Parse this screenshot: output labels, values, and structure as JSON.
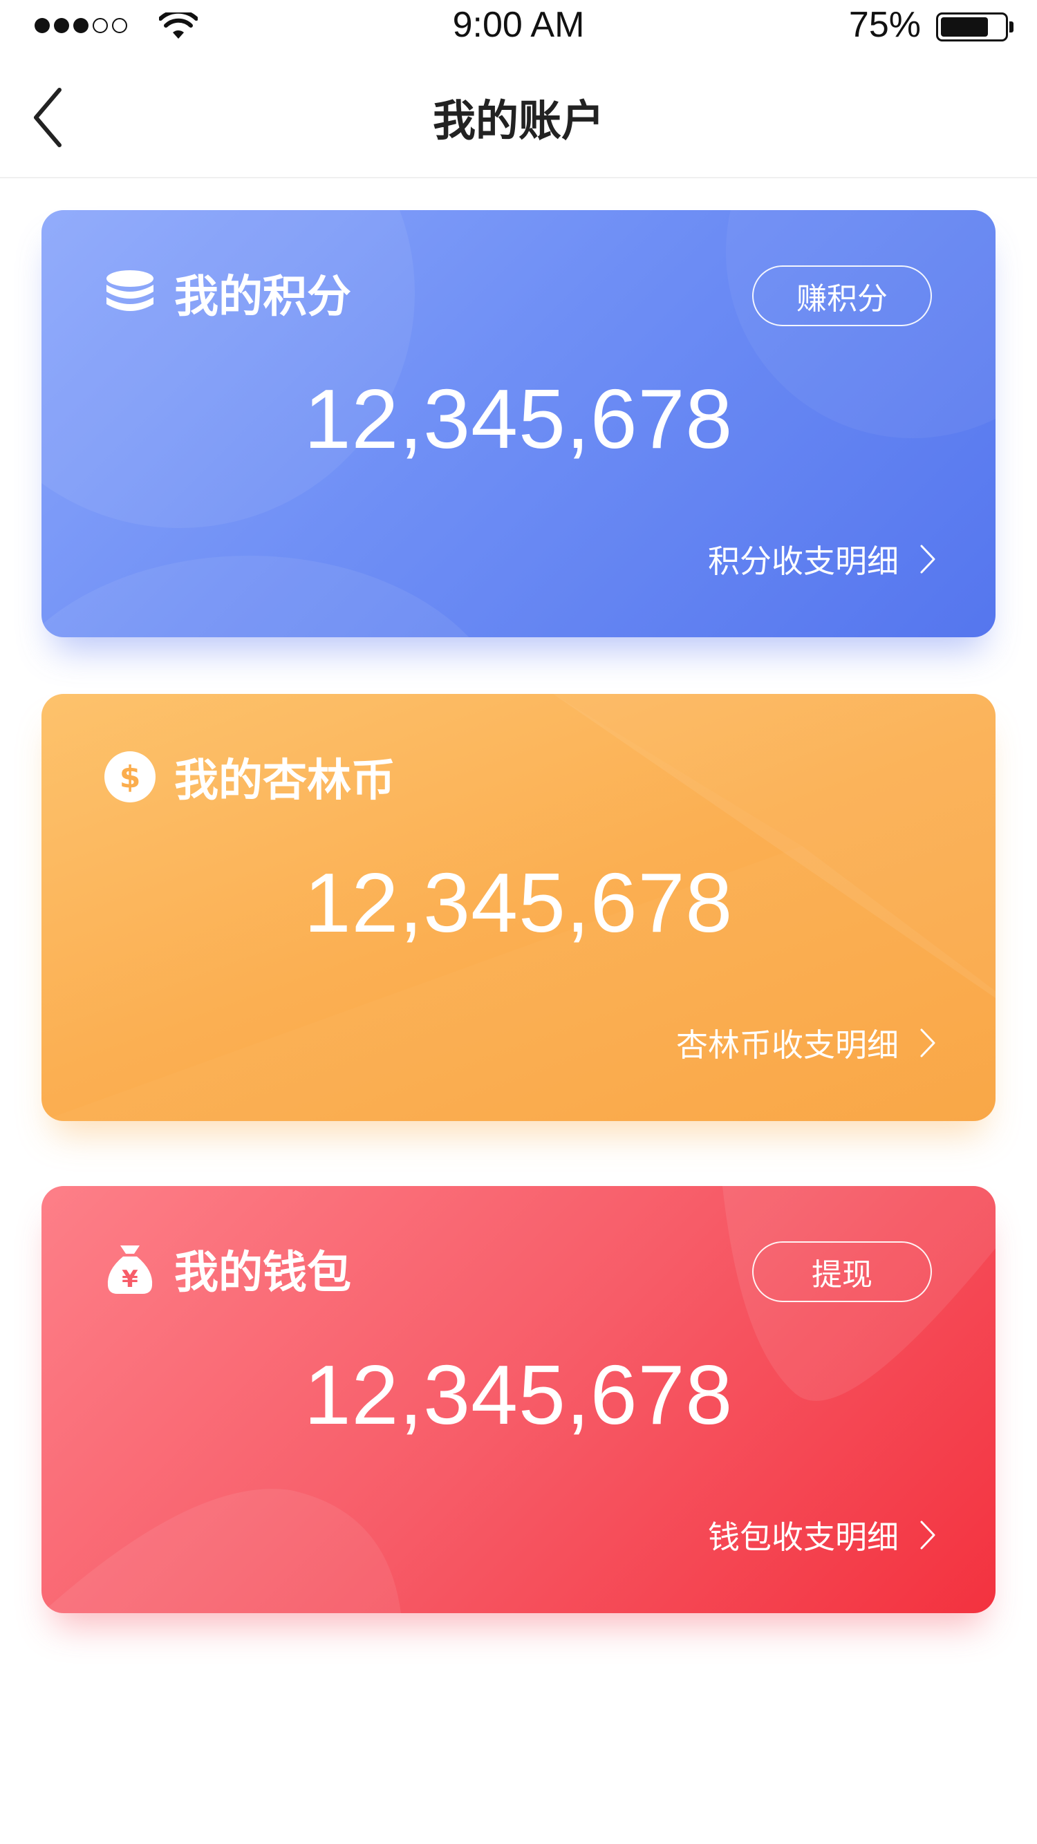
{
  "status_bar": {
    "time": "9:00 AM",
    "battery_percent": "75%",
    "battery_level": 0.75,
    "signal_bars_filled": 3,
    "signal_bars_total": 5
  },
  "nav": {
    "title": "我的账户",
    "back_icon": "chevron-left-icon"
  },
  "cards": {
    "points": {
      "icon": "coin-stack-icon",
      "title": "我的积分",
      "action_label": "赚积分",
      "amount": "12,345,678",
      "detail_label": "积分收支明细",
      "accent": "#5576ee"
    },
    "coins": {
      "icon": "dollar-coin-icon",
      "title": "我的杏林币",
      "amount": "12,345,678",
      "detail_label": "杏林币收支明细",
      "accent": "#f9a33e"
    },
    "wallet": {
      "icon": "money-bag-icon",
      "title": "我的钱包",
      "action_label": "提现",
      "amount": "12,345,678",
      "detail_label": "钱包收支明细",
      "accent": "#f3323f"
    }
  }
}
